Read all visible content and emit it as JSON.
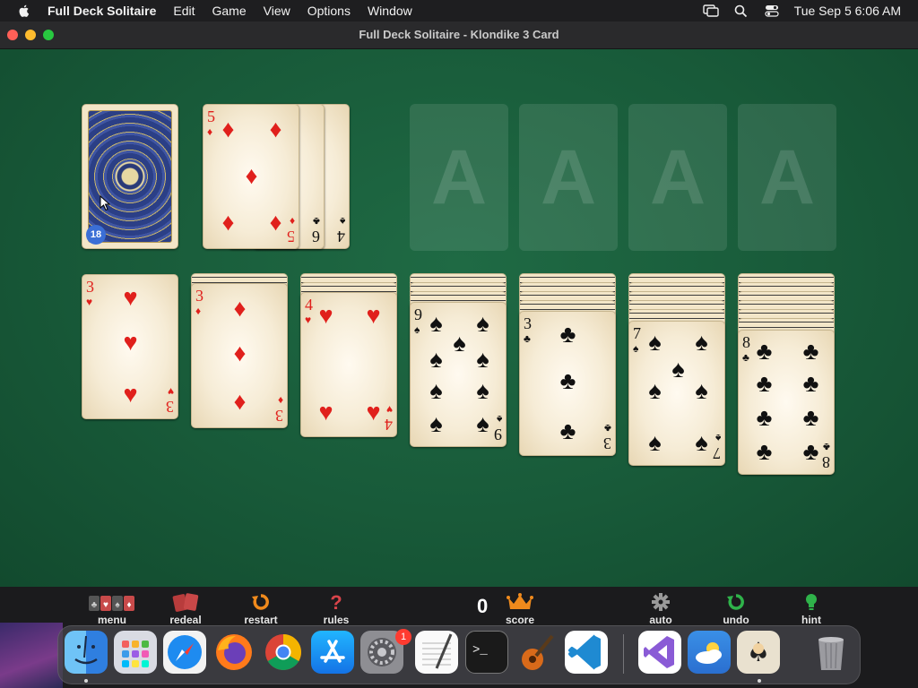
{
  "menubar": {
    "app_name": "Full Deck Solitaire",
    "items": [
      "Edit",
      "Game",
      "View",
      "Options",
      "Window"
    ],
    "clock": "Tue Sep 5  6:06 AM",
    "tray_icons": [
      "screen-mirroring-icon",
      "search-icon",
      "control-center-icon"
    ]
  },
  "window": {
    "title": "Full Deck Solitaire - Klondike 3 Card"
  },
  "game": {
    "stock_count": "18",
    "foundation_label": "A",
    "waste": [
      {
        "rank": "4",
        "suit": "♠",
        "color": "black"
      },
      {
        "rank": "6",
        "suit": "♣",
        "color": "black"
      },
      {
        "rank": "5",
        "suit": "♦",
        "color": "red"
      }
    ],
    "tableau": [
      {
        "hidden": 0,
        "rank": "3",
        "suit": "♥",
        "color": "red"
      },
      {
        "hidden": 1,
        "rank": "3",
        "suit": "♦",
        "color": "red"
      },
      {
        "hidden": 2,
        "rank": "4",
        "suit": "♥",
        "color": "red"
      },
      {
        "hidden": 3,
        "rank": "9",
        "suit": "♠",
        "color": "black"
      },
      {
        "hidden": 4,
        "rank": "3",
        "suit": "♣",
        "color": "black"
      },
      {
        "hidden": 5,
        "rank": "7",
        "suit": "♠",
        "color": "black"
      },
      {
        "hidden": 6,
        "rank": "8",
        "suit": "♣",
        "color": "black"
      }
    ]
  },
  "toolbar": {
    "menu": "menu",
    "redeal": "redeal",
    "restart": "restart",
    "rules": "rules",
    "score_value": "0",
    "score": "score",
    "auto": "auto",
    "undo": "undo",
    "hint": "hint"
  },
  "dock": {
    "apps": [
      "Finder",
      "Launchpad",
      "Safari",
      "Firefox",
      "Chrome",
      "App Store",
      "System Settings",
      "TextEdit",
      "Terminal",
      "GarageBand",
      "Visual Studio Code",
      "Visual Studio",
      "Weather",
      "Full Deck Solitaire",
      "Trash"
    ],
    "settings_badge": "1"
  },
  "colors": {
    "felt": "#185a39",
    "red_suit": "#e0201c",
    "badge_blue": "#3b6fd6"
  }
}
